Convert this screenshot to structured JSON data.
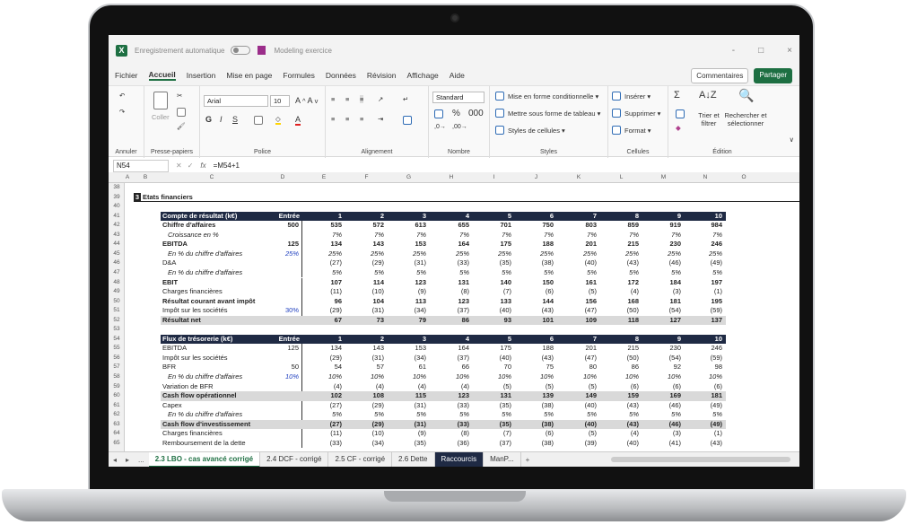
{
  "titlebar": {
    "autosave_label": "Enregistrement automatique",
    "doc_name": "Modeling exercice",
    "controls": [
      "-",
      "□",
      "×"
    ]
  },
  "menu": {
    "items": [
      "Fichier",
      "Accueil",
      "Insertion",
      "Mise en page",
      "Formules",
      "Données",
      "Révision",
      "Affichage",
      "Aide"
    ],
    "active": "Accueil",
    "comments_label": "Commentaires",
    "share_label": "Partager"
  },
  "ribbon": {
    "groups": {
      "undo": "Annuler",
      "clipboard": "Presse-papiers",
      "font": "Police",
      "alignment": "Alignement",
      "number": "Nombre",
      "styles": "Styles",
      "cells": "Cellules",
      "editing": "Édition"
    },
    "paste_label": "Coller",
    "font_name": "Arial",
    "font_size": "10",
    "number_format": "Standard",
    "cond_format": "Mise en forme conditionnelle",
    "table_format": "Mettre sous forme de tableau",
    "cell_styles": "Styles de cellules",
    "insert": "Insérer",
    "delete": "Supprimer",
    "format": "Format",
    "sort_filter": "Trier et filtrer",
    "find_select": "Rechercher et sélectionner"
  },
  "formula_bar": {
    "name_box": "N54",
    "formula": "=M54+1"
  },
  "columns": [
    "A",
    "B",
    "C",
    "D",
    "E",
    "F",
    "G",
    "H",
    "I",
    "J",
    "K",
    "L",
    "M",
    "N",
    "O"
  ],
  "section_title": "Etats financiers",
  "section_number": "3",
  "rows": [
    {
      "n": "38",
      "type": "blank"
    },
    {
      "n": "39",
      "type": "section"
    },
    {
      "n": "40",
      "type": "blank"
    },
    {
      "n": "41",
      "type": "header",
      "label": "Compte de résultat (k€)",
      "input": "Entrée",
      "vals": [
        "1",
        "2",
        "3",
        "4",
        "5",
        "6",
        "7",
        "8",
        "9",
        "10"
      ]
    },
    {
      "n": "42",
      "type": "bold",
      "label": "Chiffre d'affaires",
      "input": "500",
      "vals": [
        "535",
        "572",
        "613",
        "655",
        "701",
        "750",
        "803",
        "859",
        "919",
        "984"
      ]
    },
    {
      "n": "43",
      "type": "italic",
      "label": "Croissance en %",
      "input": "",
      "vals": [
        "7%",
        "7%",
        "7%",
        "7%",
        "7%",
        "7%",
        "7%",
        "7%",
        "7%",
        "7%"
      ]
    },
    {
      "n": "44",
      "type": "bold",
      "label": "EBITDA",
      "input": "125",
      "vals": [
        "134",
        "143",
        "153",
        "164",
        "175",
        "188",
        "201",
        "215",
        "230",
        "246"
      ]
    },
    {
      "n": "45",
      "type": "italic",
      "label": "En % du chiffre d'affaires",
      "input": "25%",
      "blue": true,
      "vals": [
        "25%",
        "25%",
        "25%",
        "25%",
        "25%",
        "25%",
        "25%",
        "25%",
        "25%",
        "25%"
      ]
    },
    {
      "n": "46",
      "type": "normal",
      "label": "D&A",
      "input": "",
      "vals": [
        "(27)",
        "(29)",
        "(31)",
        "(33)",
        "(35)",
        "(38)",
        "(40)",
        "(43)",
        "(46)",
        "(49)"
      ]
    },
    {
      "n": "47",
      "type": "italic",
      "label": "En % du chiffre d'affaires",
      "input": "",
      "vals": [
        "5%",
        "5%",
        "5%",
        "5%",
        "5%",
        "5%",
        "5%",
        "5%",
        "5%",
        "5%"
      ]
    },
    {
      "n": "48",
      "type": "bold",
      "label": "EBIT",
      "input": "",
      "vals": [
        "107",
        "114",
        "123",
        "131",
        "140",
        "150",
        "161",
        "172",
        "184",
        "197"
      ]
    },
    {
      "n": "49",
      "type": "normal",
      "label": "Charges financières",
      "input": "",
      "vals": [
        "(11)",
        "(10)",
        "(9)",
        "(8)",
        "(7)",
        "(6)",
        "(5)",
        "(4)",
        "(3)",
        "(1)"
      ]
    },
    {
      "n": "50",
      "type": "bold",
      "label": "Résultat courant avant impôt",
      "input": "",
      "vals": [
        "96",
        "104",
        "113",
        "123",
        "133",
        "144",
        "156",
        "168",
        "181",
        "195"
      ]
    },
    {
      "n": "51",
      "type": "normal",
      "label": "Impôt sur les sociétés",
      "input": "30%",
      "blue": true,
      "vals": [
        "(29)",
        "(31)",
        "(34)",
        "(37)",
        "(40)",
        "(43)",
        "(47)",
        "(50)",
        "(54)",
        "(59)"
      ]
    },
    {
      "n": "52",
      "type": "total",
      "label": "Résultat net",
      "input": "",
      "vals": [
        "67",
        "73",
        "79",
        "86",
        "93",
        "101",
        "109",
        "118",
        "127",
        "137"
      ]
    },
    {
      "n": "53",
      "type": "blank"
    },
    {
      "n": "54",
      "type": "header",
      "label": "Flux de trésorerie (k€)",
      "input": "Entrée",
      "vals": [
        "1",
        "2",
        "3",
        "4",
        "5",
        "6",
        "7",
        "8",
        "9",
        "10"
      ]
    },
    {
      "n": "55",
      "type": "normal",
      "label": "EBITDA",
      "input": "125",
      "vals": [
        "134",
        "143",
        "153",
        "164",
        "175",
        "188",
        "201",
        "215",
        "230",
        "246"
      ]
    },
    {
      "n": "56",
      "type": "normal",
      "label": "Impôt sur les sociétés",
      "input": "",
      "vals": [
        "(29)",
        "(31)",
        "(34)",
        "(37)",
        "(40)",
        "(43)",
        "(47)",
        "(50)",
        "(54)",
        "(59)"
      ]
    },
    {
      "n": "57",
      "type": "normal",
      "label": "BFR",
      "input": "50",
      "vals": [
        "54",
        "57",
        "61",
        "66",
        "70",
        "75",
        "80",
        "86",
        "92",
        "98"
      ]
    },
    {
      "n": "58",
      "type": "italic",
      "label": "En % du chiffre d'affaires",
      "input": "10%",
      "blue": true,
      "vals": [
        "10%",
        "10%",
        "10%",
        "10%",
        "10%",
        "10%",
        "10%",
        "10%",
        "10%",
        "10%"
      ]
    },
    {
      "n": "59",
      "type": "normal",
      "label": "Variation de BFR",
      "input": "",
      "vals": [
        "(4)",
        "(4)",
        "(4)",
        "(4)",
        "(5)",
        "(5)",
        "(5)",
        "(6)",
        "(6)",
        "(6)"
      ]
    },
    {
      "n": "60",
      "type": "total",
      "label": "Cash flow opérationnel",
      "input": "",
      "vals": [
        "102",
        "108",
        "115",
        "123",
        "131",
        "139",
        "149",
        "159",
        "169",
        "181"
      ]
    },
    {
      "n": "61",
      "type": "normal",
      "label": "Capex",
      "input": "",
      "vals": [
        "(27)",
        "(29)",
        "(31)",
        "(33)",
        "(35)",
        "(38)",
        "(40)",
        "(43)",
        "(46)",
        "(49)"
      ]
    },
    {
      "n": "62",
      "type": "italic",
      "label": "En % du chiffre d'affaires",
      "input": "",
      "vals": [
        "5%",
        "5%",
        "5%",
        "5%",
        "5%",
        "5%",
        "5%",
        "5%",
        "5%",
        "5%"
      ]
    },
    {
      "n": "63",
      "type": "total",
      "label": "Cash flow d'investissement",
      "input": "",
      "vals": [
        "(27)",
        "(29)",
        "(31)",
        "(33)",
        "(35)",
        "(38)",
        "(40)",
        "(43)",
        "(46)",
        "(49)"
      ]
    },
    {
      "n": "64",
      "type": "normal",
      "label": "Charges financières",
      "input": "",
      "vals": [
        "(11)",
        "(10)",
        "(9)",
        "(8)",
        "(7)",
        "(6)",
        "(5)",
        "(4)",
        "(3)",
        "(1)"
      ]
    },
    {
      "n": "65",
      "type": "normal",
      "label": "Remboursement de la dette",
      "input": "",
      "vals": [
        "(33)",
        "(34)",
        "(35)",
        "(36)",
        "(37)",
        "(38)",
        "(39)",
        "(40)",
        "(41)",
        "(43)"
      ]
    }
  ],
  "tabs": {
    "items": [
      "2.3 LBO - cas avancé corrigé",
      "2.4 DCF - corrigé",
      "2.5 CF - corrigé",
      "2.6 Dette",
      "Raccourcis",
      "ManP..."
    ],
    "active_index": 0,
    "dark_index": 4,
    "more": "...",
    "add": "+"
  },
  "colors": {
    "excel_green": "#1d6f42",
    "header_band": "#1f2a44",
    "input_blue": "#1f3fbf"
  }
}
